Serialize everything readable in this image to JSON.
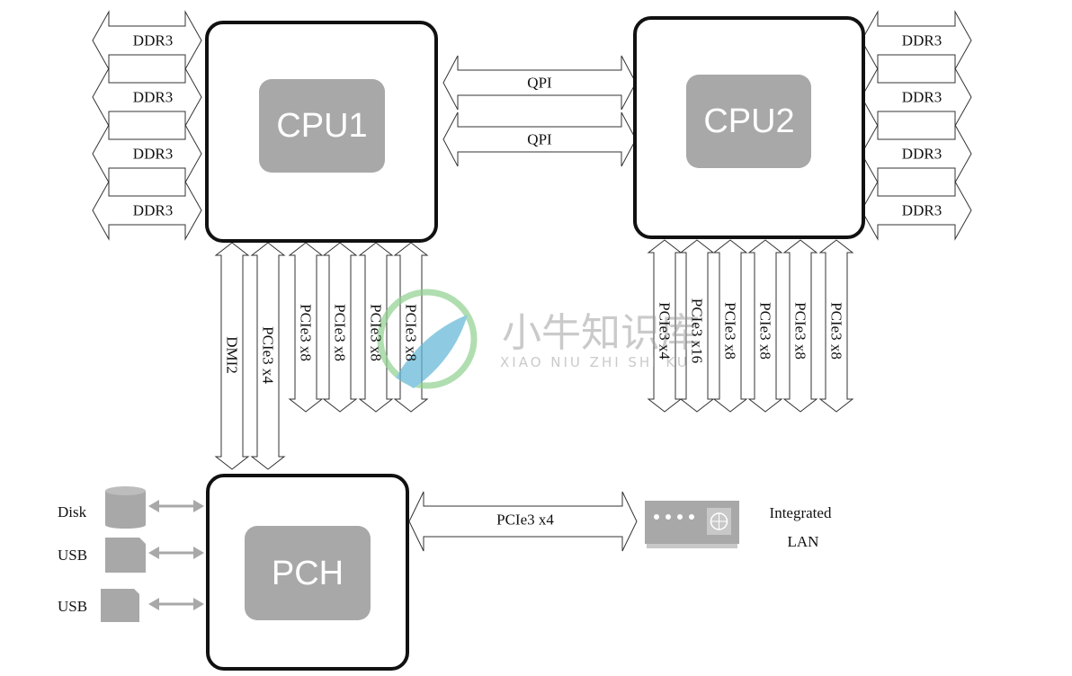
{
  "cpu1": {
    "label": "CPU1",
    "memory": [
      "DDR3",
      "DDR3",
      "DDR3",
      "DDR3"
    ],
    "links": [
      "DMI2",
      "PCIe3 x4",
      "PCIe3 x8",
      "PCIe3 x8",
      "PCIe3 x8",
      "PCIe3 x8"
    ]
  },
  "cpu2": {
    "label": "CPU2",
    "memory": [
      "DDR3",
      "DDR3",
      "DDR3",
      "DDR3"
    ],
    "links": [
      "PCIe3 x4",
      "PCIe3 x16",
      "PCIe3 x8",
      "PCIe3 x8",
      "PCIe3 x8",
      "PCIe3 x8"
    ]
  },
  "interconnect": [
    "QPI",
    "QPI"
  ],
  "pch": {
    "label": "PCH",
    "link": "PCIe3 x4",
    "peripherals": [
      {
        "label": "Disk",
        "icon": "disk-icon"
      },
      {
        "label": "USB",
        "icon": "usb-icon"
      },
      {
        "label": "USB",
        "icon": "usb-icon"
      }
    ]
  },
  "lan": {
    "line1": "Integrated",
    "line2": "LAN",
    "icon": "network-card-icon"
  },
  "watermark": {
    "text": "小牛知识库",
    "subtext": "XIAO NIU ZHI SHI KU"
  },
  "colors": {
    "chip_fill": "#a8a8a8",
    "box_stroke": "#111111",
    "peripheral": "#a8a8a8"
  }
}
